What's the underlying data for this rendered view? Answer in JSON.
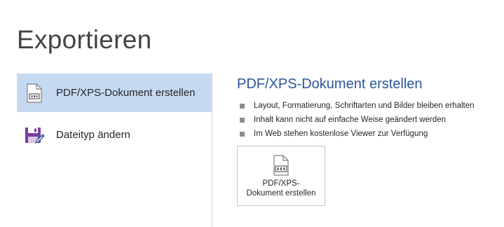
{
  "page": {
    "title": "Exportieren"
  },
  "options": [
    {
      "label": "PDF/XPS-Dokument erstellen",
      "icon": "pdf-document-icon",
      "selected": true
    },
    {
      "label": "Dateityp ändern",
      "icon": "save-as-filetype-icon",
      "selected": false
    }
  ],
  "detail": {
    "heading": "PDF/XPS-Dokument erstellen",
    "bullets": [
      "Layout, Formatierung, Schriftarten und Bilder bleiben erhalten",
      "Inhalt kann nicht auf einfache Weise geändert werden",
      "Im Web stehen kostenlose Viewer zur Verfügung"
    ],
    "button": {
      "line1": "PDF/XPS-",
      "line2": "Dokument erstellen",
      "icon": "pdf-document-icon"
    }
  },
  "colors": {
    "selected_background": "#c5d9f1",
    "heading_blue": "#2b579a",
    "save_icon_purple": "#7a3e9d"
  }
}
